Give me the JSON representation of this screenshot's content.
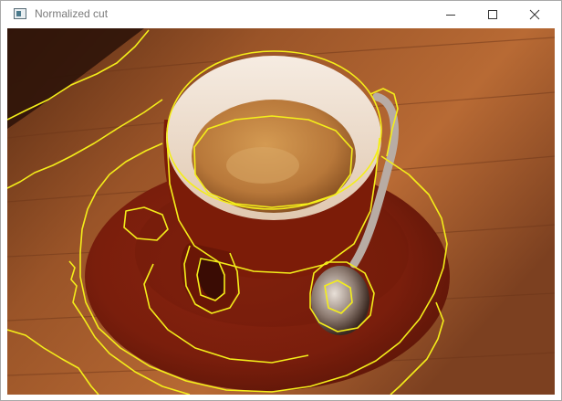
{
  "window": {
    "title": "Normalized cut",
    "controls": {
      "minimize_icon": "minimize-icon",
      "maximize_icon": "maximize-icon",
      "close_icon": "close-icon"
    }
  },
  "image": {
    "content": "segmentation-overlay",
    "boundary_color": "#f4ee1a"
  }
}
